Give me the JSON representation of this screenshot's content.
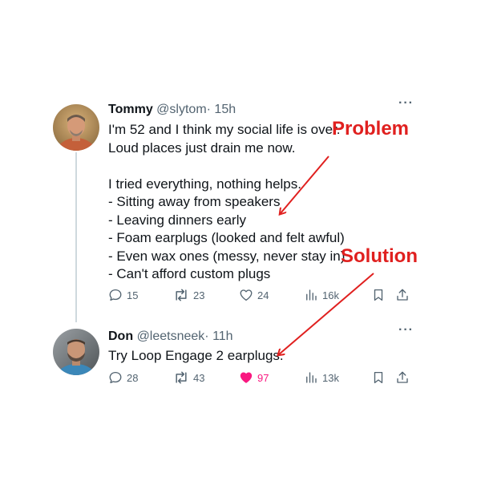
{
  "tweets": [
    {
      "author_name": "Tommy",
      "handle": "@slytom",
      "time": "· 15h",
      "more": "···",
      "lines": [
        "I'm 52 and I think my social life is over.",
        "Loud places just drain me now.",
        "",
        "I tried everything, nothing helps.",
        "- Sitting away from speakers",
        "- Leaving dinners early",
        "- Foam earplugs (looked and felt awful)",
        "- Even wax ones (messy, never stay in)",
        "- Can't afford custom plugs"
      ],
      "replies": "15",
      "retweets": "23",
      "likes": "24",
      "views": "16k",
      "liked": false
    },
    {
      "author_name": "Don",
      "handle": "@leetsneek",
      "time": "· 11h",
      "more": "···",
      "lines": [
        "Try Loop Engage 2 earplugs."
      ],
      "replies": "28",
      "retweets": "43",
      "likes": "97",
      "views": "13k",
      "liked": true
    }
  ],
  "annotations": {
    "problem": "Problem",
    "solution": "Solution"
  },
  "colors": {
    "annotation": "#e0201f",
    "like_active": "#f91880",
    "meta": "#536471"
  },
  "icons": [
    "reply-icon",
    "retweet-icon",
    "like-icon",
    "views-icon",
    "bookmark-icon",
    "share-icon",
    "more-icon"
  ]
}
